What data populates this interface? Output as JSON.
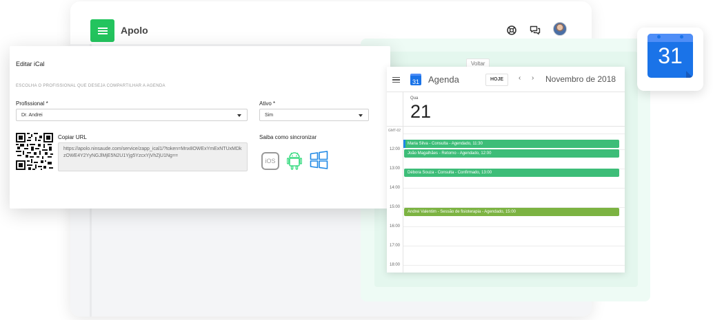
{
  "app": {
    "brand": "Apolo"
  },
  "voltar_label": "Voltar",
  "modal": {
    "title": "Editar iCal",
    "subtitle": "ESCOLHA O PROFISSIONAL QUE DESEJA COMPARTILHAR A AGENDA",
    "profissional_label": "Profissional *",
    "profissional_value": "Dr. Andrei",
    "ativo_label": "Ativo *",
    "ativo_value": "Sim",
    "copiar_url_label": "Copiar URL",
    "url_value": "https://apolo.ninsaude.com/service/zapp_ical1/?token=Mnx8OWExYmExNTUxMDkzOWE4Y2YyNGJlMjE5N2U1Yjg5YzcxYjVhZjU1Ng==",
    "saiba_label": "Saiba como sincronizar",
    "ios_label": "iOS"
  },
  "calendar": {
    "logo_num": "31",
    "name": "Agenda",
    "today_button": "HOJE",
    "prev_icon": "‹",
    "next_icon": "›",
    "month": "Novembro de 2018",
    "day_of_week": "Qua",
    "day_number": "21",
    "timezone": "GMT-02",
    "hours": [
      "12:00",
      "13:00",
      "14:00",
      "15:00",
      "16:00",
      "17:00",
      "18:00"
    ],
    "events": [
      "Maria Silva - Consulta - Agendado, 11:30",
      "João Magalhães - Retorno - Agendado, 12:00",
      "Débora Souza - Consulta - Confirmado, 13:00",
      "Andrei Valentim - Sessão de fisioterapia - Agendado, 15:00"
    ]
  },
  "gcal_icon_num": "31",
  "colors": {
    "brand_green": "#23c45e",
    "event_green": "#3dbd78",
    "event_lime": "#7cb342",
    "google_blue": "#1a73e8"
  }
}
